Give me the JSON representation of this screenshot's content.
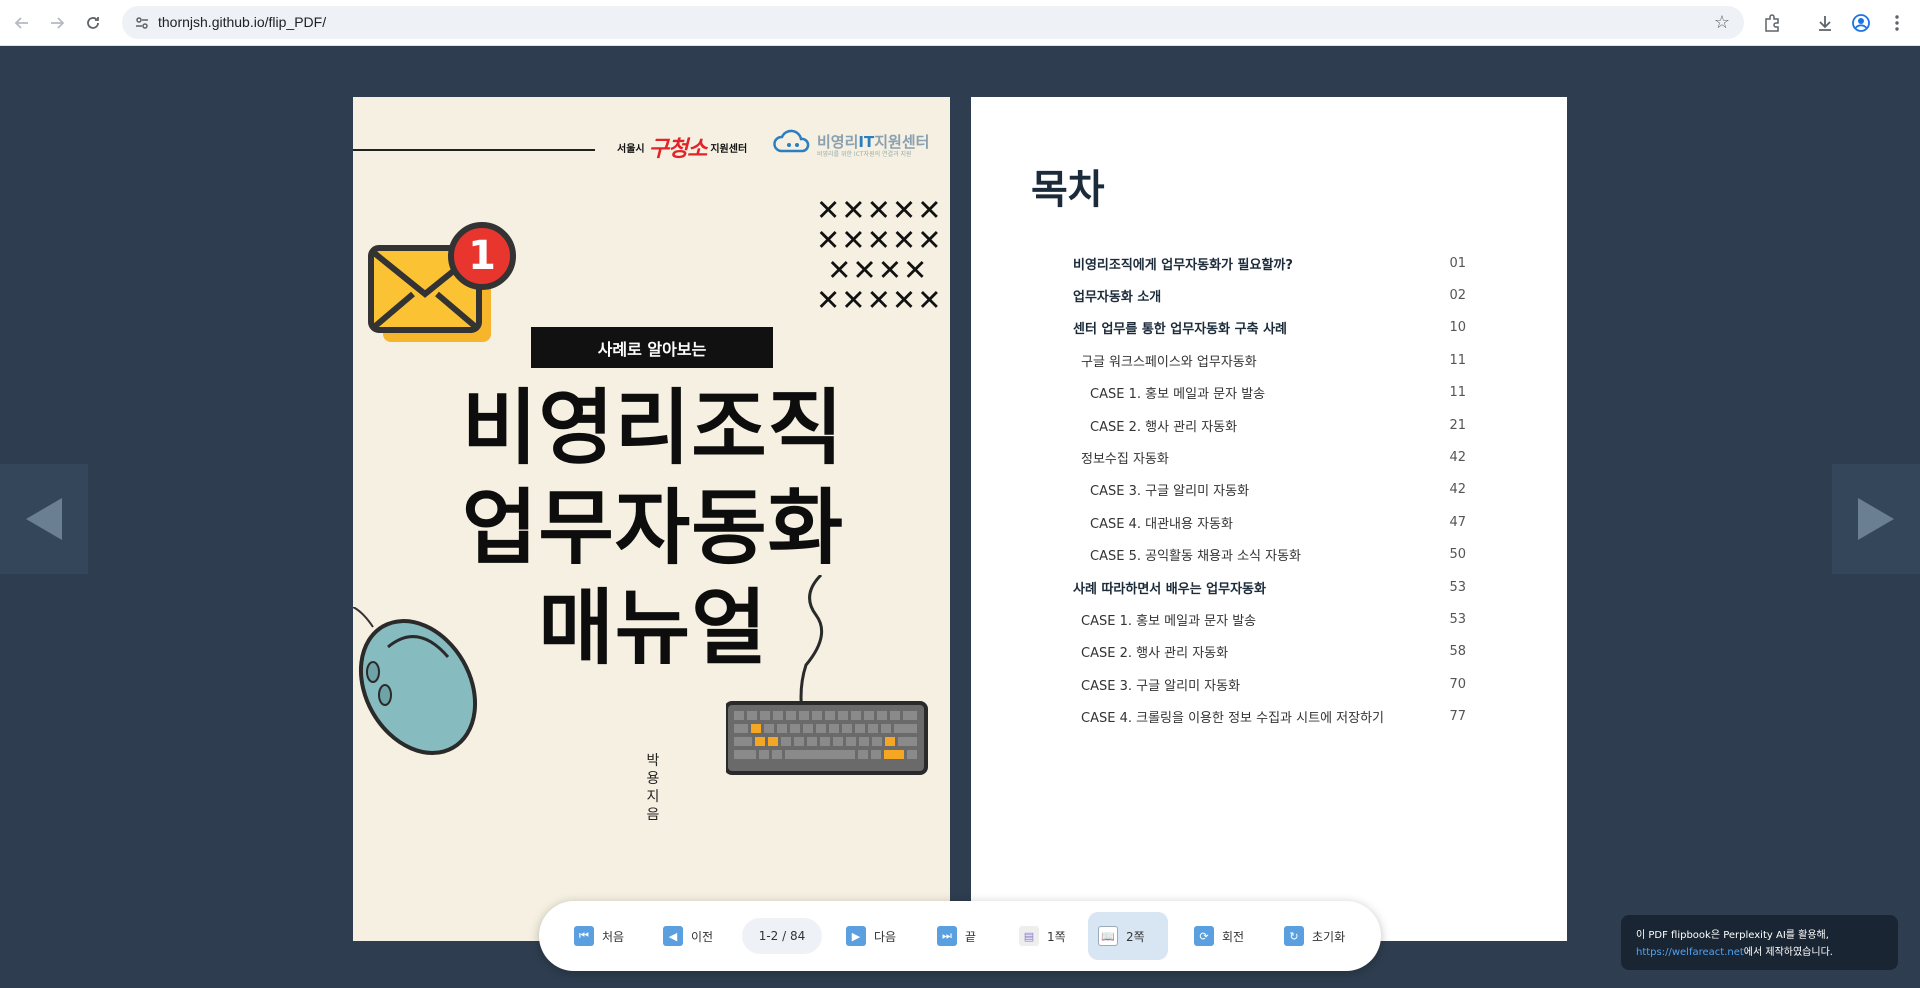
{
  "browser": {
    "url": "thornjsh.github.io/flip_PDF/",
    "back_icon": "back-arrow-icon",
    "forward_icon": "forward-arrow-icon",
    "reload_icon": "reload-icon"
  },
  "cover": {
    "logo_seoul_prefix": "서울시",
    "logo_seoul_brand": "구청소",
    "logo_seoul_suffix": "지원센터",
    "logo_it_name_a": "비영리",
    "logo_it_name_b": "IT",
    "logo_it_name_c": "지원센터",
    "logo_it_sub": "비영리를 위한 ICT자원의 연결과 지원",
    "badge": "1",
    "subtitle": "사례로 알아보는",
    "title_line1": "비영리조직",
    "title_line2": "업무자동화",
    "title_line3": "매뉴얼",
    "author": "박용 지음"
  },
  "toc": {
    "title": "목차",
    "items": [
      {
        "label": "비영리조직에게 업무자동화가 필요할까?",
        "page": "01",
        "level": 0
      },
      {
        "label": "업무자동화 소개",
        "page": "02",
        "level": 0
      },
      {
        "label": "센터 업무를 통한 업무자동화 구축 사례",
        "page": "10",
        "level": 0
      },
      {
        "label": "구글 워크스페이스와 업무자동화",
        "page": "11",
        "level": 1
      },
      {
        "label": "CASE 1. 홍보 메일과 문자 발송",
        "page": "11",
        "level": 2
      },
      {
        "label": "CASE 2. 행사 관리 자동화",
        "page": "21",
        "level": 2
      },
      {
        "label": "정보수집 자동화",
        "page": "42",
        "level": 1
      },
      {
        "label": "CASE 3. 구글 알리미 자동화",
        "page": "42",
        "level": 2
      },
      {
        "label": "CASE 4. 대관내용 자동화",
        "page": "47",
        "level": 2
      },
      {
        "label": "CASE 5. 공익활동 채용과 소식 자동화",
        "page": "50",
        "level": 2
      },
      {
        "label": "사례 따라하면서 배우는 업무자동화",
        "page": "53",
        "level": 0
      },
      {
        "label": "CASE 1. 홍보 메일과 문자 발송",
        "page": "53",
        "level": 1
      },
      {
        "label": "CASE 2. 행사 관리 자동화",
        "page": "58",
        "level": 1
      },
      {
        "label": "CASE 3. 구글 알리미 자동화",
        "page": "70",
        "level": 1
      },
      {
        "label": "CASE 4. 크롤링을 이용한 정보 수집과 시트에 저장하기",
        "page": "77",
        "level": 1
      }
    ]
  },
  "toolbar": {
    "first": "처음",
    "prev": "이전",
    "page_indicator": "1-2 / 84",
    "next": "다음",
    "last": "끝",
    "single": "1쪽",
    "double": "2쪽",
    "rotate": "회전",
    "reset": "초기화"
  },
  "notice": {
    "line1": "이 PDF flipbook은 Perplexity AI를 활용해,",
    "link": "https://welfareact.net",
    "line2_suffix": "에서 제작하였습니다."
  }
}
